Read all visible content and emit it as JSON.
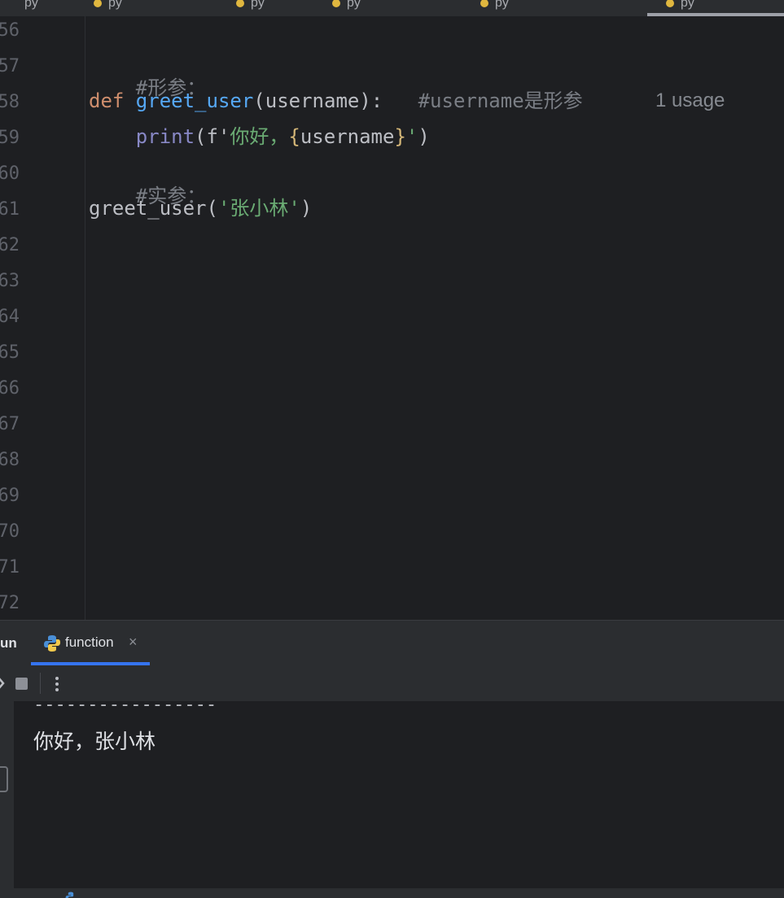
{
  "editor": {
    "line_numbers": [
      "56",
      "57",
      "58",
      "59",
      "60",
      "61",
      "62",
      "63",
      "64",
      "65",
      "66",
      "67",
      "68",
      "69",
      "70",
      "71",
      "72"
    ],
    "line57_comment": "#形参：",
    "line58": {
      "kw": "def ",
      "fn": "greet_user",
      "params": "(username):",
      "comment": "#username是形参"
    },
    "usage_hint": "1 usage",
    "line59": {
      "builtin": "print",
      "open": "(f'",
      "text": "你好，",
      "brace_open": "{",
      "var": "username",
      "brace_close": "}",
      "close_str": "'",
      "close_paren": ")"
    },
    "line60_comment": "#实参：",
    "line61": {
      "call": "greet_user(",
      "arg": "'张小林'",
      "close": ")"
    }
  },
  "run_panel": {
    "title": "un",
    "tab_label": "function",
    "tab_close": "×",
    "console_separator": "-----------------",
    "console_output": "你好，张小林"
  },
  "colors": {
    "keyword": "#cf8e6d",
    "function": "#56a8f5",
    "string": "#6aab73",
    "comment": "#7a7e85",
    "accent": "#3574f0"
  }
}
